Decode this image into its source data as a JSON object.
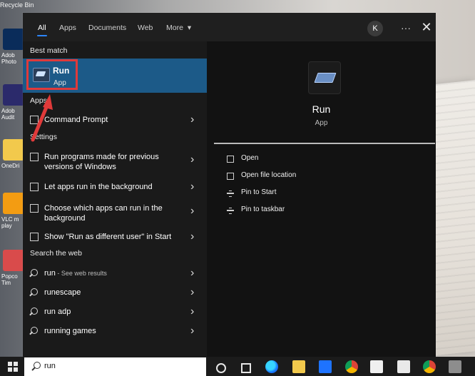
{
  "desktop": {
    "recycle_bin_label": "Recycle Bin",
    "icons": [
      {
        "label": "Adob Photo",
        "color": "#0a2c5a"
      },
      {
        "label": "Adob Audit",
        "color": "#2b2a6b"
      },
      {
        "label": "OneDri",
        "color": "#f2c94c"
      },
      {
        "label": "VLC m play",
        "color": "#f39c12"
      },
      {
        "label": "Popco Tim",
        "color": "#d94b4b"
      }
    ]
  },
  "search_panel": {
    "tabs": [
      {
        "label": "All",
        "active": true
      },
      {
        "label": "Apps",
        "active": false
      },
      {
        "label": "Documents",
        "active": false
      },
      {
        "label": "Web",
        "active": false
      },
      {
        "label": "More",
        "active": false
      }
    ],
    "user_initial": "K",
    "more_dots": "···",
    "close_symbol": "✕",
    "best_match_title": "Best match",
    "best_match": {
      "name": "Run",
      "type": "App"
    },
    "apps_title": "Apps",
    "apps": [
      {
        "label": "Command Prompt"
      }
    ],
    "settings_title": "Settings",
    "settings": [
      {
        "label": "Run programs made for previous versions of Windows"
      },
      {
        "label": "Let apps run in the background"
      },
      {
        "label": "Choose which apps can run in the background"
      },
      {
        "label": "Show \"Run as different user\" in Start"
      }
    ],
    "web_title": "Search the web",
    "web": [
      {
        "label": "run",
        "sub": " - See web results"
      },
      {
        "label": "runescape",
        "sub": ""
      },
      {
        "label": "run adp",
        "sub": ""
      },
      {
        "label": "running games",
        "sub": ""
      }
    ],
    "detail": {
      "name": "Run",
      "type": "App",
      "actions": [
        {
          "label": "Open",
          "icon": "open-icon"
        },
        {
          "label": "Open file location",
          "icon": "file-location-icon"
        },
        {
          "label": "Pin to Start",
          "icon": "pin-icon"
        },
        {
          "label": "Pin to taskbar",
          "icon": "pin-icon"
        }
      ]
    }
  },
  "taskbar": {
    "search_query": "run"
  },
  "colors": {
    "highlight": "#e03a3a",
    "selected_row": "#1c5a88",
    "tab_underline": "#2d86ff"
  },
  "chevron": "›",
  "caret": "▾"
}
